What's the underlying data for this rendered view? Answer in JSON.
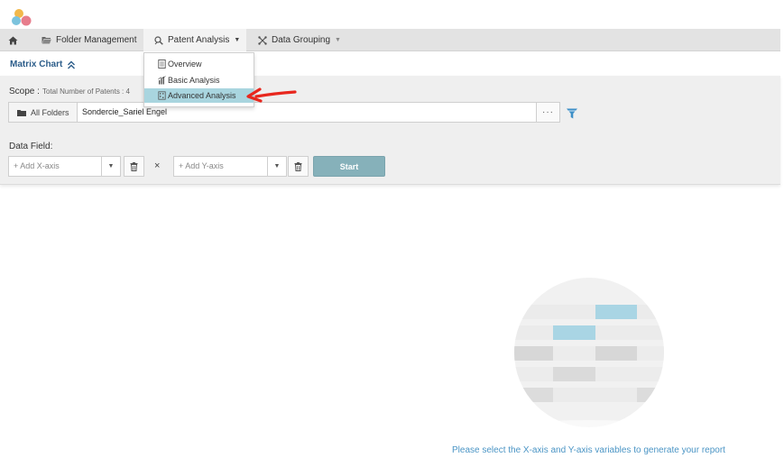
{
  "header": {
    "logo": "app-logo-dots"
  },
  "nav": {
    "home_icon": "home-icon",
    "folder_management": "Folder Management",
    "patent_analysis": "Patent Analysis",
    "data_grouping": "Data Grouping"
  },
  "patent_menu": {
    "items": [
      {
        "label": "Overview",
        "icon": "document-icon",
        "selected": false
      },
      {
        "label": "Basic Analysis",
        "icon": "bar-chart-icon",
        "selected": false
      },
      {
        "label": "Advanced Analysis",
        "icon": "matrix-icon",
        "selected": true
      }
    ]
  },
  "page": {
    "title": "Matrix Chart"
  },
  "scope": {
    "label": "Scope :",
    "count_text": "Total Number of Patents : 4",
    "folder_button": "All Folders",
    "value": "Sondercie_Sariel Engel",
    "more_button": "···"
  },
  "data_field": {
    "label": "Data Field:",
    "x_placeholder": "+ Add X-axis",
    "y_placeholder": "+ Add Y-axis",
    "times": "×",
    "start": "Start"
  },
  "empty_state": {
    "hint": "Please select the X-axis and Y-axis variables to generate your report"
  },
  "colors": {
    "nav_bg": "#e3e3e3",
    "panel_bg": "#efefef",
    "accent_title": "#2c5d8a",
    "start_button": "#86b1ba",
    "menu_selected": "#a9d5df",
    "hint_text": "#4b95c5",
    "annotation_arrow": "#e8271e"
  }
}
